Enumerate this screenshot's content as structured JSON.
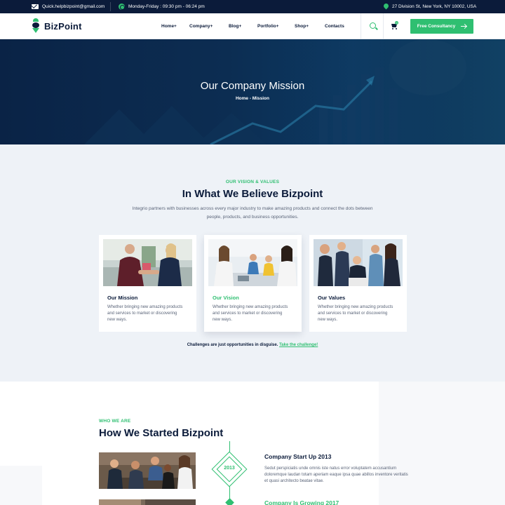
{
  "topbar": {
    "email": "Quick.helpbizpoint@gmail.com",
    "hours": "Monday-Friday : 09:30 pm - 06:24 pm",
    "address": "27 Division St, New York, NY 10002, USA"
  },
  "header": {
    "brand": "BizPoint",
    "nav": [
      "Home+",
      "Company+",
      "Blog+",
      "Portfolio+",
      "Shop+",
      "Contacts"
    ],
    "cart_count": "0",
    "cta_label": "Free Consultancy",
    "icons": [
      "mail-icon",
      "clock-icon",
      "map-pin-icon",
      "search-icon",
      "cart-icon",
      "arrow-right-icon"
    ]
  },
  "hero": {
    "title": "Our Company Mission",
    "breadcrumb": "Home - Mission"
  },
  "vision": {
    "eyebrow": "OUR VISION & VALUES",
    "title": "In What We Believe Bizpoint",
    "intro": "Integrio partners with businesses across every major industry to make amazing products and connect the dots between people, products, and business opportunities.",
    "cards": [
      {
        "title": "Our Mission",
        "text": "Whether bringing new amazing products and services to market or discovering new ways."
      },
      {
        "title": "Our Vision",
        "text": "Whether bringing new amazing products and services to market or discovering new ways."
      },
      {
        "title": "Our Values",
        "text": "Whether bringing new amazing products and services to market or discovering new ways."
      }
    ],
    "tagline_text": "Challenges are just opportunities in disguise.",
    "tagline_link": "Take the challenge!"
  },
  "history": {
    "eyebrow": "WHO WE ARE",
    "title": "How We Started Bizpoint",
    "entries": [
      {
        "year": "2013",
        "title": "Company Start Up 2013",
        "text": "Sedut perspiciatis unde omnis iste natus error voluptatem accusantium doloremque laudan totam aperiam eaque ipsa quae abillos inventore veritatis et quasi architecto beatae vitae."
      },
      {
        "title": "Company Is Growing 2017"
      }
    ]
  },
  "colors": {
    "accent": "#2fbf71",
    "navy": "#0b1b3a",
    "section_bg": "#eef2f7"
  }
}
